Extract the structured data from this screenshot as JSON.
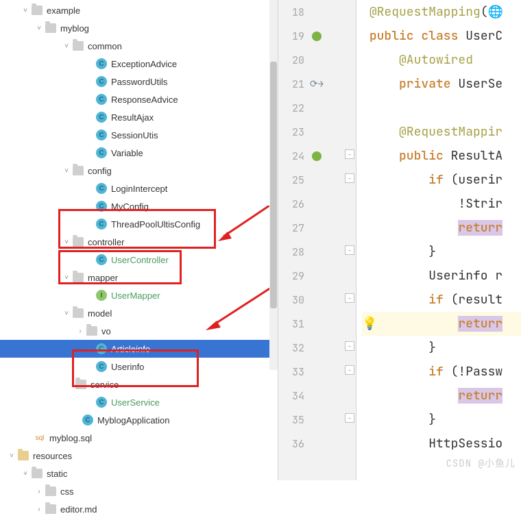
{
  "tree": {
    "root": "example",
    "myblog": "myblog",
    "common": {
      "label": "common",
      "items": [
        "ExceptionAdvice",
        "PasswordUtils",
        "ResponseAdvice",
        "ResultAjax",
        "SessionUtis",
        "Variable"
      ]
    },
    "config": {
      "label": "config",
      "items": [
        "LoginIntercept",
        "MyConfig",
        "ThreadPoolUltisConfig"
      ]
    },
    "controller": {
      "label": "controller",
      "items": [
        "UserController"
      ]
    },
    "mapper": {
      "label": "mapper",
      "items": [
        "UserMapper"
      ]
    },
    "model": {
      "label": "model",
      "vo": "vo",
      "items": [
        "Articleinfo",
        "Userinfo"
      ]
    },
    "service": {
      "label": "service",
      "items": [
        "UserService"
      ]
    },
    "app": "MyblogApplication",
    "sql": "myblog.sql",
    "resources": "resources",
    "static": "static",
    "css": "css",
    "editor": "editor.md"
  },
  "gutter": {
    "start": 18,
    "end": 36
  },
  "code": {
    "l18": {
      "ann": "@RequestMapping",
      "rest": "("
    },
    "l19": {
      "kw": "public class",
      "rest": " UserC"
    },
    "l20": "@Autowired",
    "l21": {
      "kw": "private",
      "rest": " UserSe"
    },
    "l22": "",
    "l23": "@RequestMappir",
    "l24": {
      "kw": "public",
      "rest": " ResultA"
    },
    "l25": {
      "kw": "if",
      "rest": " (userir"
    },
    "l26": "!Strir",
    "l27": "returr",
    "l28": "}",
    "l29": "Userinfo r",
    "l30": {
      "kw": "if",
      "rest": " (result"
    },
    "l31": "returr",
    "l32": "}",
    "l33": {
      "kw": "if",
      "rest": " (!Passw"
    },
    "l34": "returr",
    "l35": "}",
    "l36": "HttpSessio"
  },
  "watermark": "CSDN @小鱼儿"
}
